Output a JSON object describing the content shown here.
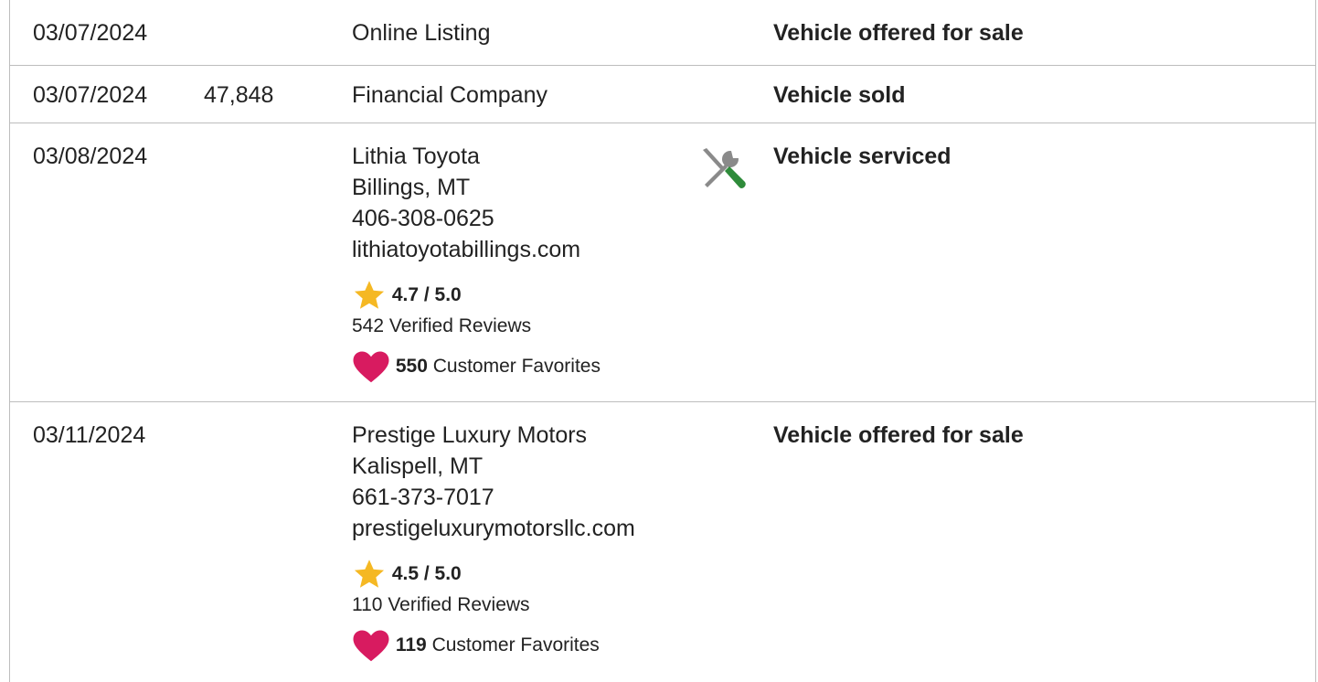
{
  "history": {
    "rows": [
      {
        "date": "03/07/2024",
        "odometer": "",
        "source_lines": [
          "Online Listing"
        ],
        "comment": "Vehicle offered for sale"
      },
      {
        "date": "03/07/2024",
        "odometer": "47,848",
        "source_lines": [
          "Financial Company"
        ],
        "comment": "Vehicle sold"
      },
      {
        "date": "03/08/2024",
        "odometer": "",
        "source_lines": [
          "Lithia Toyota",
          "Billings, MT",
          "406-308-0625",
          "lithiatoyotabillings.com"
        ],
        "rating": "4.7 / 5.0",
        "reviews": "542 Verified Reviews",
        "favorites_count": "550",
        "favorites_label": "Customer Favorites",
        "icon": "service-tools-icon",
        "comment": "Vehicle serviced"
      },
      {
        "date": "03/11/2024",
        "odometer": "",
        "source_lines": [
          "Prestige Luxury Motors",
          "Kalispell, MT",
          "661-373-7017",
          "prestigeluxurymotorsllc.com"
        ],
        "rating": "4.5 / 5.0",
        "reviews": "110 Verified Reviews",
        "favorites_count": "119",
        "favorites_label": "Customer Favorites",
        "comment": "Vehicle offered for sale"
      }
    ]
  },
  "colors": {
    "border": "#bdbdbd",
    "star": "#f5b823",
    "heart": "#d81b60",
    "wrench_gray": "#8a8a8a",
    "screwdriver_green": "#2e8b3a"
  }
}
